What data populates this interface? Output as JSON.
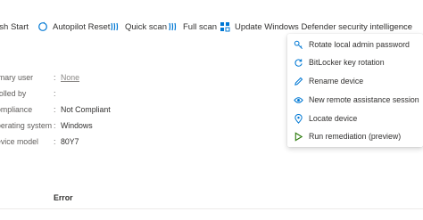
{
  "toolbar": {
    "refresh_start": "esh Start",
    "autopilot_reset": "Autopilot Reset",
    "quick_scan": "Quick scan",
    "full_scan": "Full scan",
    "update_defender": "Update Windows Defender security intelligence",
    "more": "···"
  },
  "properties": [
    {
      "label": "imary user",
      "value": "None"
    },
    {
      "label": "rolled by",
      "value": ""
    },
    {
      "label": "ompliance",
      "value": "Not Compliant"
    },
    {
      "label": "perating system",
      "value": "Windows"
    },
    {
      "label": "evice model",
      "value": "80Y7"
    }
  ],
  "table": {
    "error_header": "Error"
  },
  "menu": {
    "items": [
      {
        "label": "Rotate local admin password",
        "icon": "key-icon"
      },
      {
        "label": "BitLocker key rotation",
        "icon": "bitlocker-icon"
      },
      {
        "label": "Rename device",
        "icon": "pencil-icon"
      },
      {
        "label": "New remote assistance session",
        "icon": "remote-assistance-icon"
      },
      {
        "label": "Locate device",
        "icon": "location-pin-icon"
      },
      {
        "label": "Run remediation (preview)",
        "icon": "play-icon"
      }
    ]
  },
  "colors": {
    "accent": "#0078d4",
    "highlight": "#f2f24a",
    "play_icon": "#2b7a0b"
  }
}
